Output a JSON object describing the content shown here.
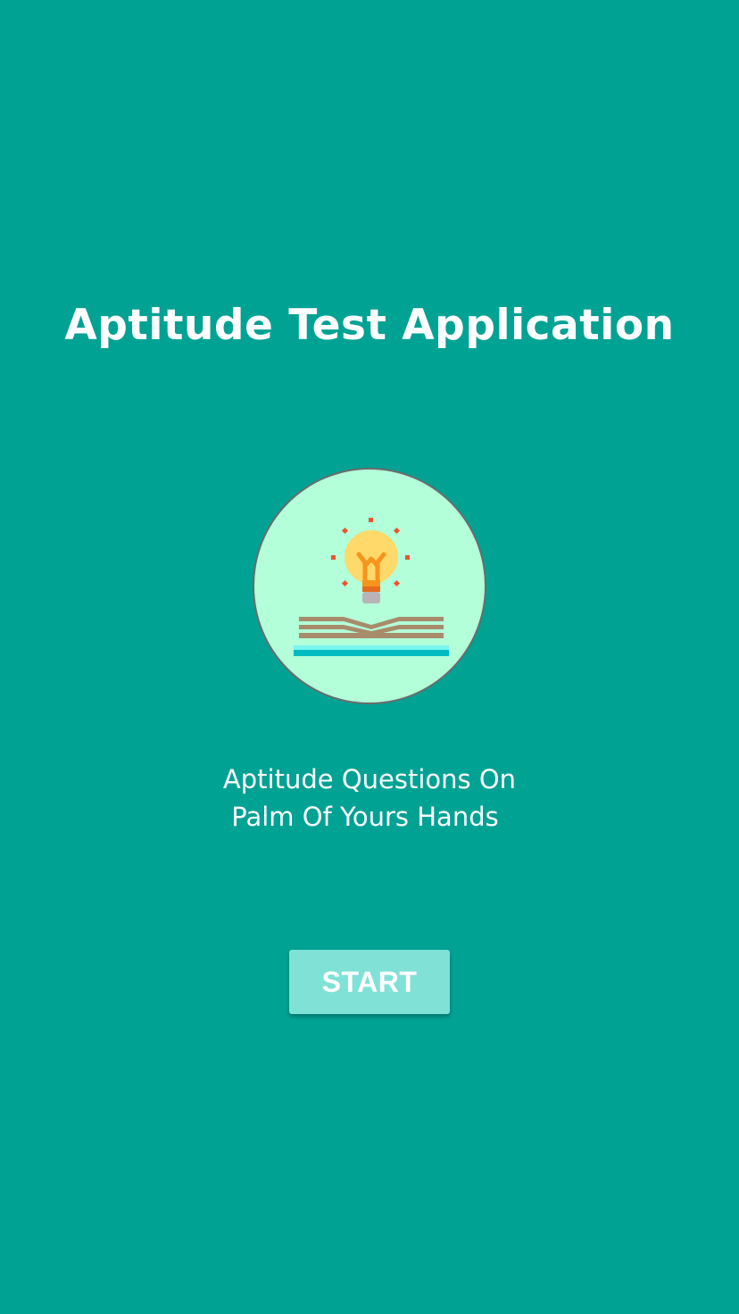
{
  "app": {
    "title": "Aptitude Test Application",
    "tagline_line1": "Aptitude Questions On",
    "tagline_line2": "Palm Of Yours Hands",
    "start_label": "START"
  },
  "logo": {
    "icon": "lightbulb-book-icon"
  },
  "colors": {
    "background": "#00A294",
    "logo_background": "#B2FFDA",
    "button": "#80E2D6",
    "text": "#FFFFFF"
  }
}
